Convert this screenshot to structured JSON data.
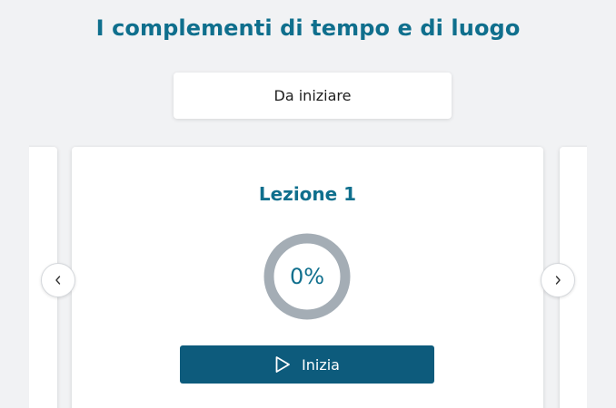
{
  "page": {
    "title": "I complementi di tempo e di luogo"
  },
  "status": {
    "label": "Da iniziare"
  },
  "carousel": {
    "current_lesson": {
      "title": "Lezione 1",
      "progress": 0,
      "progress_label": "0%",
      "button_label": "Inizia",
      "button_icon": "play-icon"
    },
    "prev_icon": "chevron-left-icon",
    "next_icon": "chevron-right-icon"
  },
  "colors": {
    "accent": "#0f6f8d",
    "button": "#0d5b7c",
    "ring_track": "#a4adb5",
    "background": "#f1f2f4"
  }
}
